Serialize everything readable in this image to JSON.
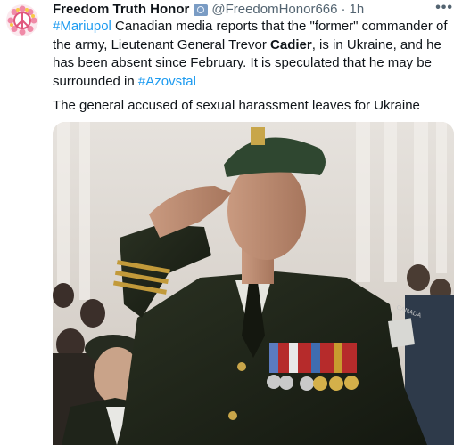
{
  "tweet": {
    "display_name": "Freedom Truth Honor",
    "handle": "@FreedomHonor666",
    "separator": "·",
    "time": "1h",
    "more": "•••",
    "text": {
      "hashtag1": "#Mariupol",
      "t1": " Canadian media reports that the \"former\" commander of the army, Lieutenant General Trevor ",
      "name_bold": "Cadier",
      "t2": ", is in Ukraine, and he has been absent since February. It is speculated that he may be surrounded in ",
      "hashtag2": "#Azovstal"
    },
    "subtitle": "The general accused of sexual harassment leaves for Ukraine"
  },
  "media": {
    "alt_hint": "soldier-saluting-photo",
    "patch_text": "CANADA"
  },
  "colors": {
    "link": "#1d9bf0",
    "text": "#0f1419",
    "muted": "#536471"
  }
}
